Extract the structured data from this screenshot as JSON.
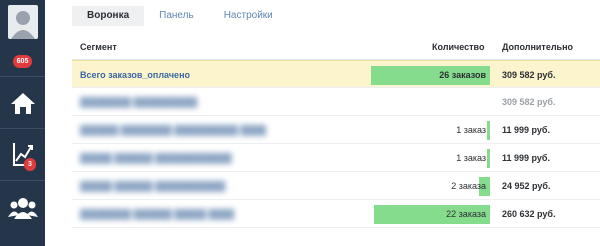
{
  "sidebar": {
    "badge_main": "605",
    "badge_chart": "3"
  },
  "tabs": [
    {
      "label": "Воронка",
      "active": true
    },
    {
      "label": "Панель",
      "active": false
    },
    {
      "label": "Настройки",
      "active": false
    }
  ],
  "table": {
    "headers": {
      "segment": "Сегмент",
      "quantity": "Количество",
      "extra": "Дополнительно"
    },
    "rows": [
      {
        "segment": "Всего заказов_оплачено",
        "quantity": "26 заказов",
        "extra": "309 582 руб.",
        "bar_fraction": 0.9
      },
      {
        "segment": "",
        "quantity": "",
        "extra": "309 582 руб.",
        "bar_fraction": 0
      },
      {
        "segment": "",
        "quantity": "1 заказ",
        "extra": "11 999 руб.",
        "bar_fraction": 0.02
      },
      {
        "segment": "",
        "quantity": "1 заказ",
        "extra": "11 999 руб.",
        "bar_fraction": 0.02
      },
      {
        "segment": "",
        "quantity": "2 заказа",
        "extra": "24 952 руб.",
        "bar_fraction": 0.08
      },
      {
        "segment": "",
        "quantity": "22 заказа",
        "extra": "260 632 руб.",
        "bar_fraction": 0.88
      }
    ]
  },
  "colors": {
    "sidebar": "#25364a",
    "bar": "#86dc8d",
    "highlight": "#fbf4cd",
    "badge": "#e23b3b",
    "link": "#3a67a3"
  }
}
